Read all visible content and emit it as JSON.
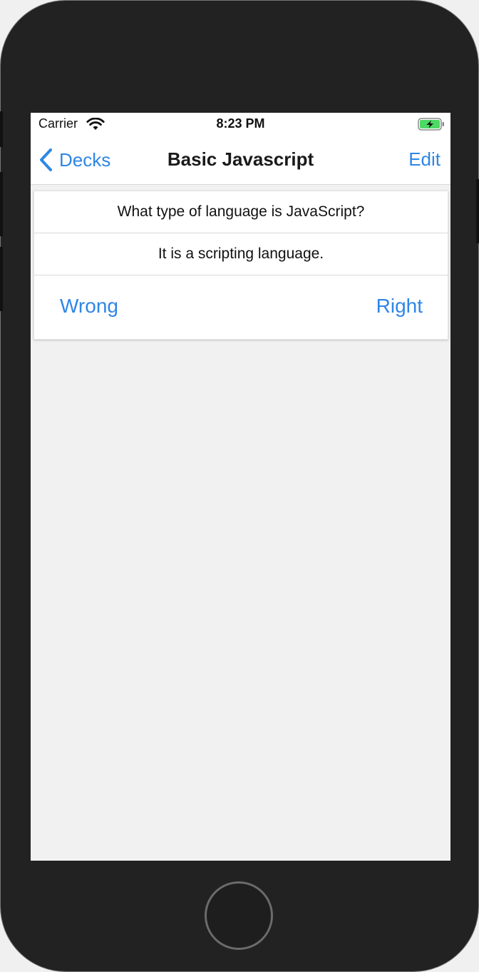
{
  "status_bar": {
    "carrier": "Carrier",
    "time": "8:23 PM",
    "wifi_icon": "wifi-icon",
    "battery_icon": "battery-charging-icon",
    "battery_color": "#4cd964"
  },
  "nav": {
    "back_label": "Decks",
    "title": "Basic Javascript",
    "edit_label": "Edit",
    "accent_color": "#2f86e6"
  },
  "card": {
    "question": "What type of language is JavaScript?",
    "answer": "It is a scripting language.",
    "wrong_label": "Wrong",
    "right_label": "Right"
  }
}
